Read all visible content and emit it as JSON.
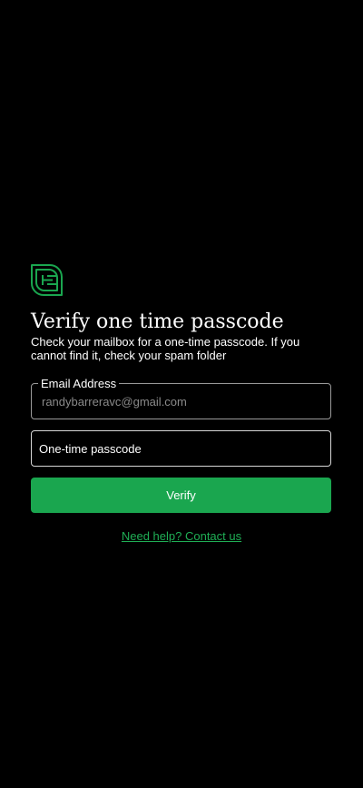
{
  "brand": {
    "logo_icon": "brand-logo-icon",
    "accent_color": "#1aa64f",
    "link_color": "#1fae55"
  },
  "heading": {
    "title": "Verify one time passcode",
    "subtitle": "Check your mailbox for a one-time passcode. If you cannot find it, check your spam folder"
  },
  "email_field": {
    "label": "Email Address",
    "value": "randybarreravc@gmail.com"
  },
  "otp_field": {
    "placeholder": "One-time passcode"
  },
  "actions": {
    "verify_label": "Verify",
    "help_link_label": "Need help? Contact us"
  }
}
